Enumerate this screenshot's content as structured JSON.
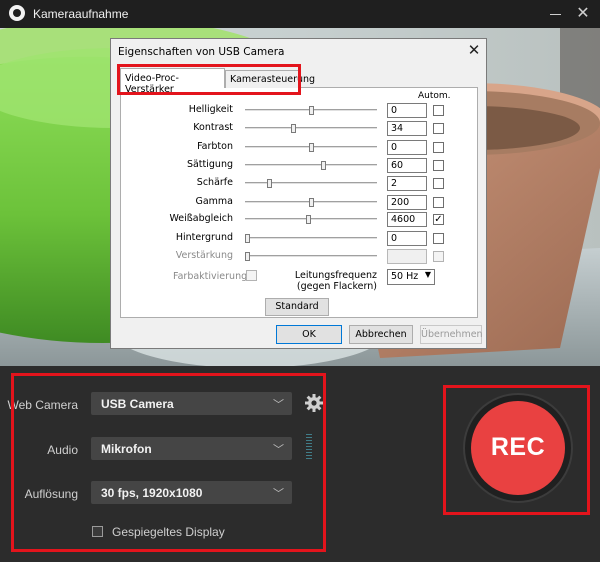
{
  "window": {
    "title": "Kameraaufnahme",
    "minimize_label": "Minimieren",
    "close_label": "✕"
  },
  "dialog": {
    "title": "Eigenschaften von USB Camera",
    "close_glyph": "✕",
    "tabs": [
      {
        "label": "Video-Proc-Verstärker",
        "selected": true
      },
      {
        "label": "Kamerasteuerung",
        "selected": false
      }
    ],
    "autom_header": "Autom.",
    "properties": [
      {
        "label": "Helligkeit",
        "value": "0",
        "slider": 0.5,
        "auto": false,
        "enabled": true
      },
      {
        "label": "Kontrast",
        "value": "34",
        "slider": 0.36,
        "auto": false,
        "enabled": true
      },
      {
        "label": "Farbton",
        "value": "0",
        "slider": 0.5,
        "auto": false,
        "enabled": true
      },
      {
        "label": "Sättigung",
        "value": "60",
        "slider": 0.6,
        "auto": false,
        "enabled": true
      },
      {
        "label": "Schärfe",
        "value": "2",
        "slider": 0.17,
        "auto": false,
        "enabled": true
      },
      {
        "label": "Gamma",
        "value": "200",
        "slider": 0.5,
        "auto": false,
        "enabled": true
      },
      {
        "label": "Weißabgleich",
        "value": "4600",
        "slider": 0.48,
        "auto": true,
        "enabled": true
      },
      {
        "label": "Hintergrund",
        "value": "0",
        "slider": 0.0,
        "auto": false,
        "enabled": true
      },
      {
        "label": "Verstärkung",
        "value": "",
        "slider": 0.0,
        "auto": false,
        "enabled": false
      }
    ],
    "farbaktivierung_label": "Farbaktivierung",
    "frequency_label": "Leitungsfrequenz\n(gegen Flackern)",
    "frequency_value": "50 Hz",
    "standard_button": "Standard",
    "ok_button": "OK",
    "cancel_button": "Abbrechen",
    "apply_button": "Übernehmen"
  },
  "controls": {
    "webcam_label": "Web Camera",
    "webcam_value": "USB Camera",
    "audio_label": "Audio",
    "audio_value": "Mikrofon",
    "resolution_label": "Auflösung",
    "resolution_value": "30 fps, 1920x1080",
    "mirror_label": "Gespiegeltes Display",
    "mirror_checked": false,
    "rec_label": "REC"
  },
  "colors": {
    "rec_button": "#e94141",
    "highlight": "#e3141c",
    "panel_bg": "#2c2c2c"
  }
}
